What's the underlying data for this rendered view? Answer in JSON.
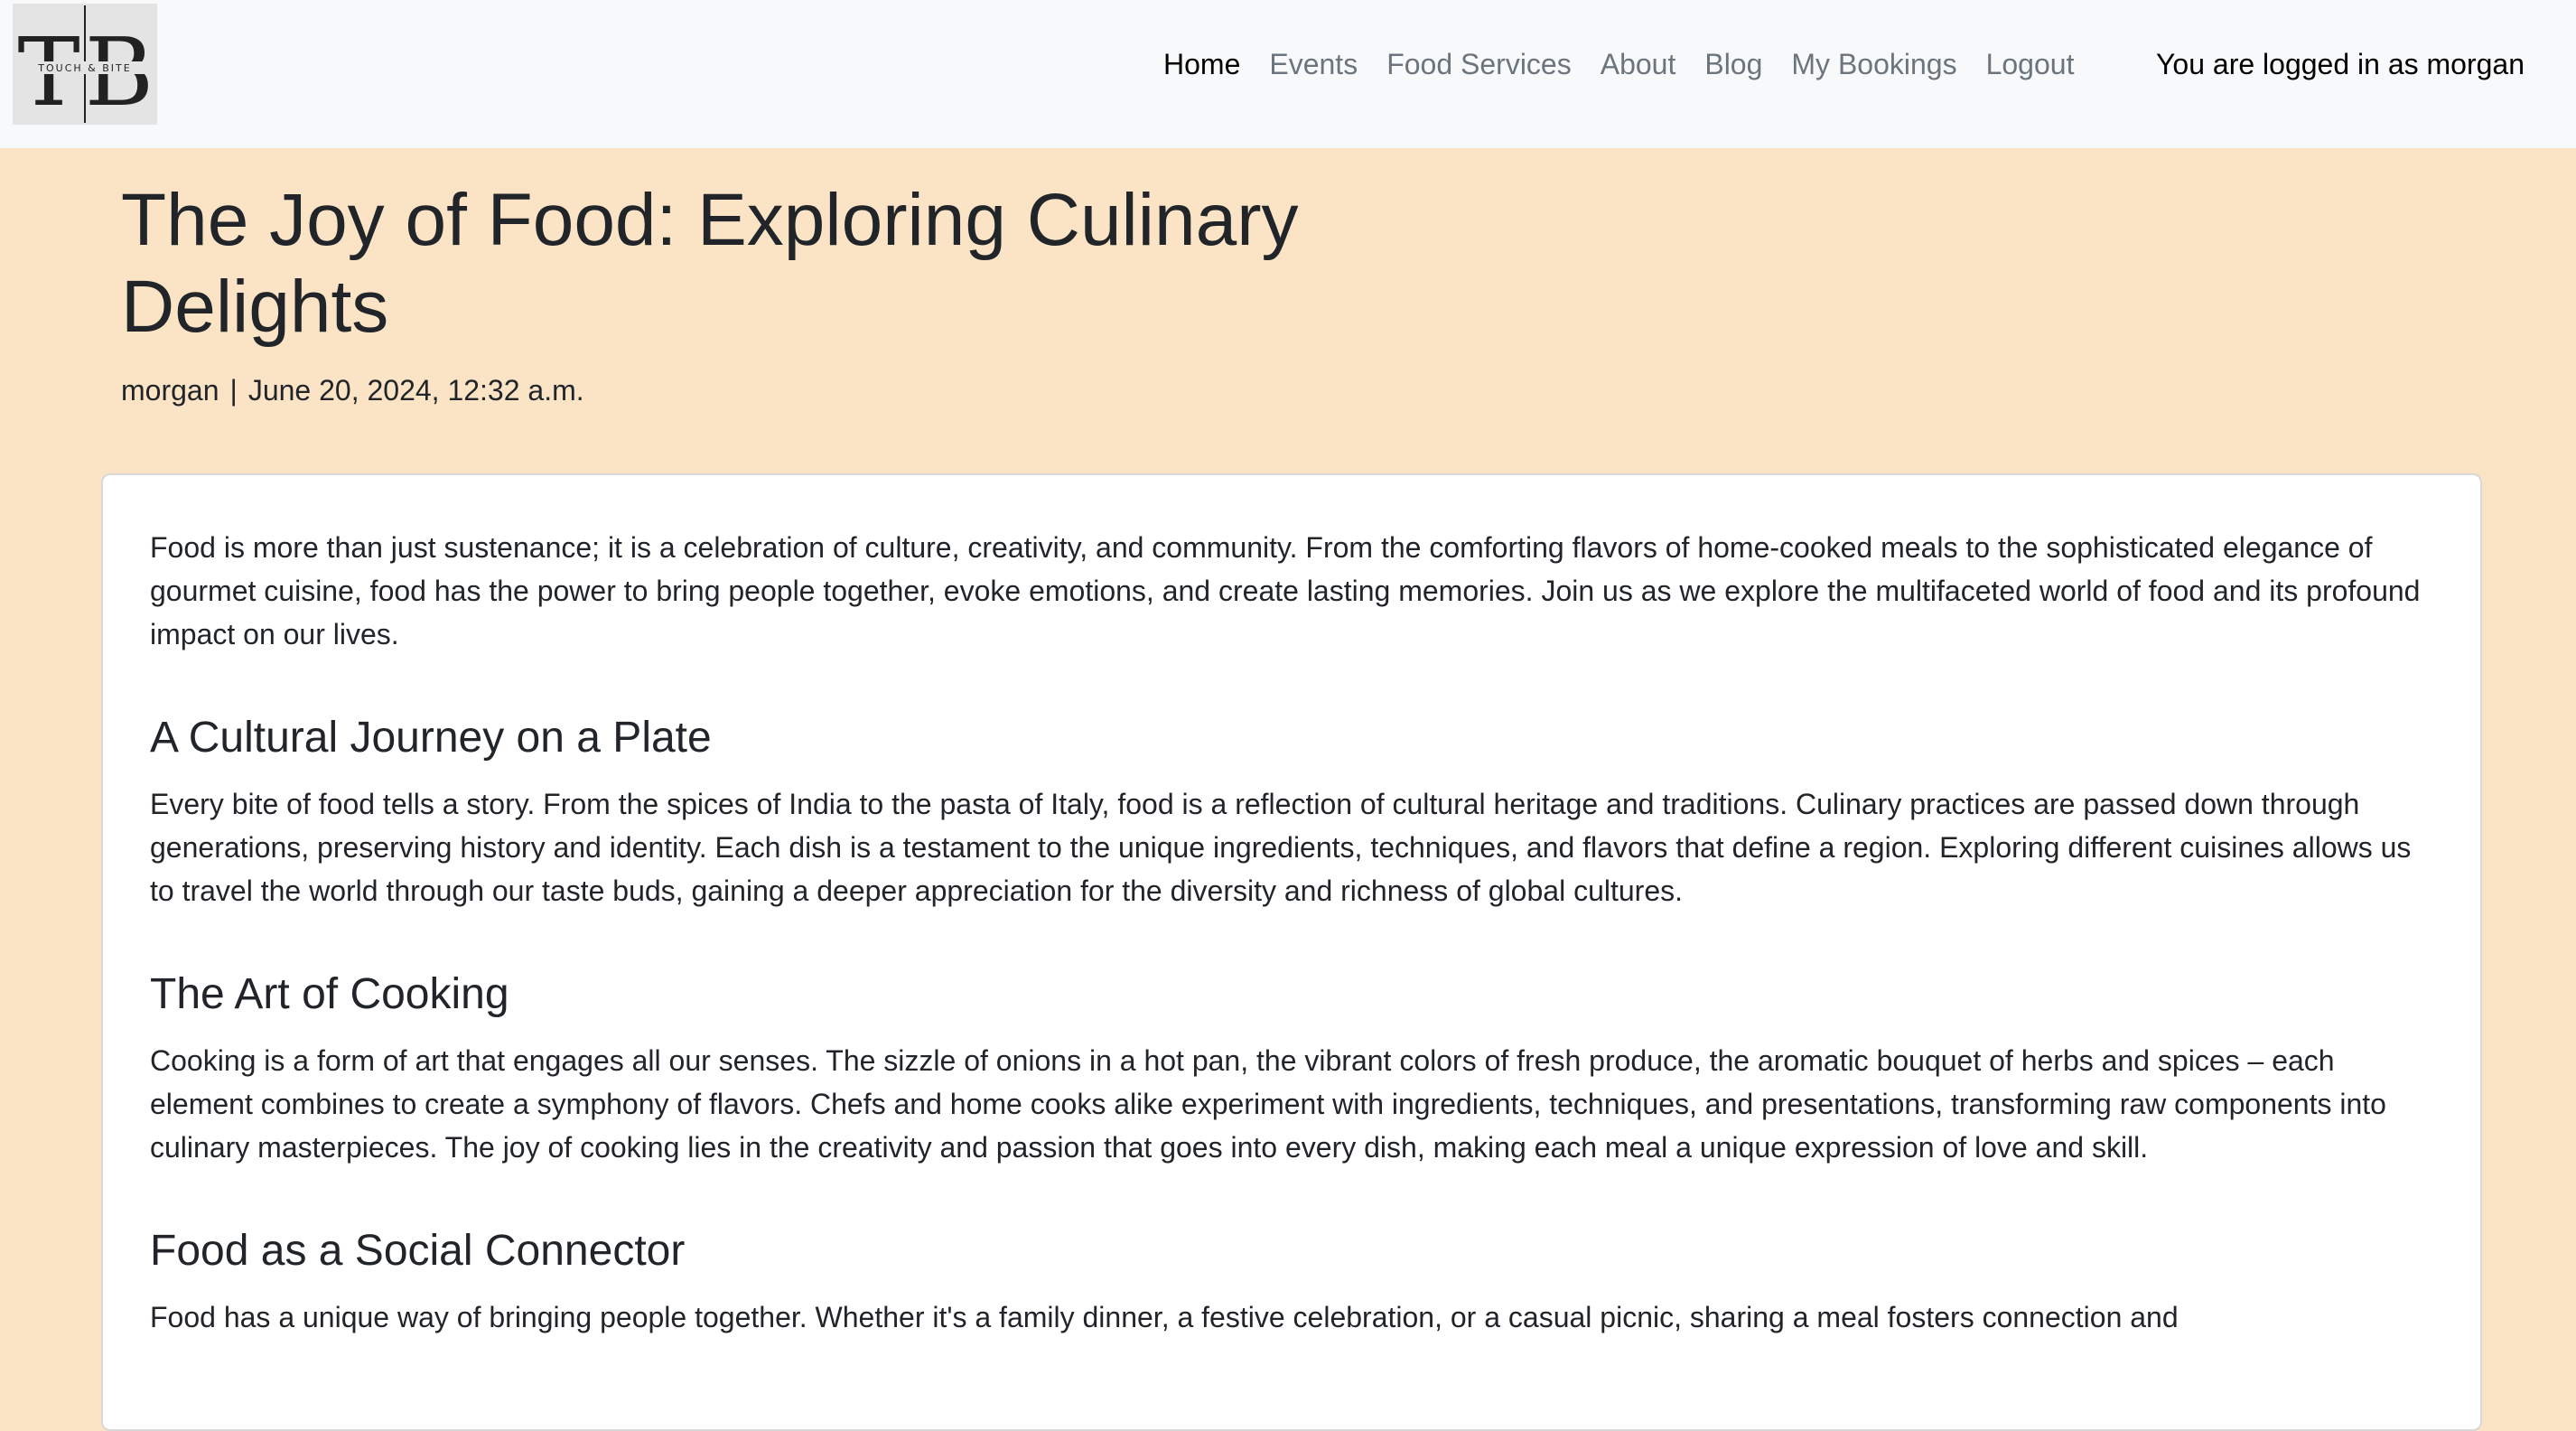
{
  "brand": {
    "logo_letters": "TB",
    "logo_text": "TOUCH & BITE"
  },
  "nav": {
    "items": [
      {
        "label": "Home",
        "active": true
      },
      {
        "label": "Events",
        "active": false
      },
      {
        "label": "Food Services",
        "active": false
      },
      {
        "label": "About",
        "active": false
      },
      {
        "label": "Blog",
        "active": false
      },
      {
        "label": "My Bookings",
        "active": false
      },
      {
        "label": "Logout",
        "active": false
      }
    ],
    "user_status": "You are logged in as morgan"
  },
  "post": {
    "title": "The Joy of Food: Exploring Culinary Delights",
    "author": "morgan",
    "separator": "|",
    "date": "June 20, 2024, 12:32 a.m.",
    "intro": "Food is more than just sustenance; it is a celebration of culture, creativity, and community. From the comforting flavors of home-cooked meals to the sophisticated elegance of gourmet cuisine, food has the power to bring people together, evoke emotions, and create lasting memories. Join us as we explore the multifaceted world of food and its profound impact on our lives.",
    "sections": [
      {
        "heading": "A Cultural Journey on a Plate",
        "body": "Every bite of food tells a story. From the spices of India to the pasta of Italy, food is a reflection of cultural heritage and traditions. Culinary practices are passed down through generations, preserving history and identity. Each dish is a testament to the unique ingredients, techniques, and flavors that define a region. Exploring different cuisines allows us to travel the world through our taste buds, gaining a deeper appreciation for the diversity and richness of global cultures."
      },
      {
        "heading": "The Art of Cooking",
        "body": "Cooking is a form of art that engages all our senses. The sizzle of onions in a hot pan, the vibrant colors of fresh produce, the aromatic bouquet of herbs and spices – each element combines to create a symphony of flavors. Chefs and home cooks alike experiment with ingredients, techniques, and presentations, transforming raw components into culinary masterpieces. The joy of cooking lies in the creativity and passion that goes into every dish, making each meal a unique expression of love and skill."
      },
      {
        "heading": "Food as a Social Connector",
        "body": "Food has a unique way of bringing people together. Whether it's a family dinner, a festive celebration, or a casual picnic, sharing a meal fosters connection and"
      }
    ]
  },
  "colors": {
    "page_background": "#fbe4c6",
    "navbar_background": "#f8f9fa",
    "nav_link": "#6c757d",
    "nav_active": "#000000",
    "text": "#212529",
    "card_background": "#ffffff"
  }
}
